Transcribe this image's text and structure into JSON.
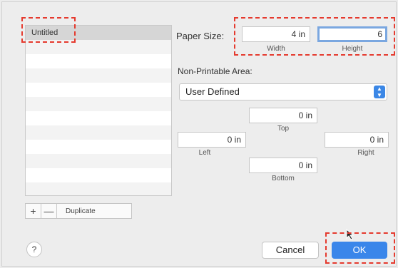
{
  "paper_list": {
    "items": [
      "Untitled",
      "",
      "",
      "",
      "",
      "",
      "",
      "",
      "",
      "",
      "",
      ""
    ]
  },
  "list_controls": {
    "add": "+",
    "remove": "—",
    "duplicate": "Duplicate"
  },
  "paper_size": {
    "label": "Paper Size:",
    "width_value": "4 in",
    "width_caption": "Width",
    "height_value": "6",
    "height_caption": "Height"
  },
  "non_printable": {
    "label": "Non-Printable Area:",
    "selected": "User Defined",
    "top_value": "0 in",
    "top_caption": "Top",
    "left_value": "0 in",
    "left_caption": "Left",
    "right_value": "0 in",
    "right_caption": "Right",
    "bottom_value": "0 in",
    "bottom_caption": "Bottom"
  },
  "buttons": {
    "help": "?",
    "cancel": "Cancel",
    "ok": "OK"
  },
  "colors": {
    "accent": "#3a86ea",
    "annotation": "#e53a2e"
  }
}
